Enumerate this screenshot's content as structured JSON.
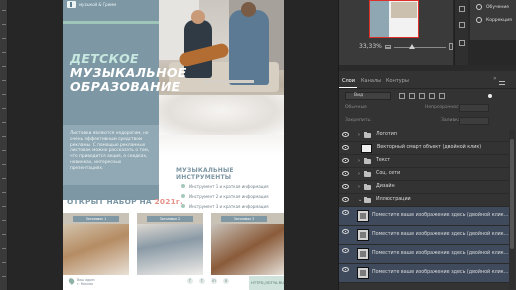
{
  "flyer": {
    "logo_text": "музыкой & Гримм",
    "title_line1": "ДЕТСКОЕ",
    "title_line2": "МУЗЫКАЛЬНОЕ",
    "title_line3": "ОБРАЗОВАНИЕ",
    "description": "Листовки являются недорогим, но очень эффективным средством рекламы. С помощью рекламных листовок можно рассказать о том, что приводится акция, о скидках, новинках, интересных презентациях.",
    "instruments_title": "МУЗЫКАЛЬНЫЕ ИНСТРУМЕНТЫ",
    "instruments": [
      "Инструмент 1 и краткая информация",
      "Инструмент 2 и краткая информация",
      "Инструмент 3 и краткая информация"
    ],
    "enroll_text": "ОТКРЫТ НАБОР НА ",
    "enroll_year": "2021г.",
    "cards": [
      {
        "label": "Заголовок 1"
      },
      {
        "label": "Заголовок 2"
      },
      {
        "label": "Заголовок 3"
      }
    ],
    "address_line1": "Ваш адрес",
    "address_line2": "г. Москва",
    "social": [
      "f",
      "t",
      "in",
      "o"
    ],
    "website": "HTTPS://SITYA.RU"
  },
  "navigator": {
    "zoom": "33,33%"
  },
  "adjustments": {
    "items": [
      "Обучение",
      "Коррекция"
    ]
  },
  "layers_panel": {
    "tabs": [
      "Слои",
      "Каналы",
      "Контуры"
    ],
    "collapse_icon": "»",
    "filter_label": "Вид",
    "blend_mode": "Обычные",
    "opacity_label": "Непрозрачность:",
    "lock_label": "Закрепить:",
    "fill_label": "Заливка:",
    "rows": [
      {
        "type": "folder",
        "name": "Логотип"
      },
      {
        "type": "smart",
        "name": "Векторный смарт объект (двойной клик)"
      },
      {
        "type": "folder",
        "name": "Текст"
      },
      {
        "type": "folder",
        "name": "Соц. сети"
      },
      {
        "type": "folder",
        "name": "Дизайн"
      },
      {
        "type": "folder-open",
        "name": "Иллюстрации"
      },
      {
        "type": "image",
        "name": "Поместите ваше изображение здесь (двойной клик..."
      },
      {
        "type": "image",
        "name": "Поместите ваше изображение здесь (двойной клик..."
      },
      {
        "type": "image",
        "name": "Поместите ваше изображение здесь (двойной клик..."
      },
      {
        "type": "image",
        "name": "Поместите ваше изображение здесь (двойной клик..."
      }
    ]
  },
  "colors": {
    "flyer_blue": "#7d98a4",
    "flyer_mint": "#a7c9bd",
    "accent_year": "#e5928a",
    "panel_bg": "#333333",
    "selected_row": "#3f4b5d"
  }
}
